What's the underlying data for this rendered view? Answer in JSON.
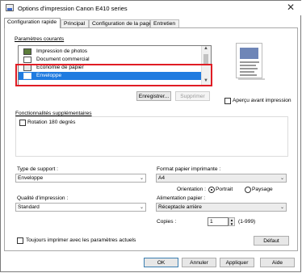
{
  "window": {
    "title": "Options d'impression Canon E410 series",
    "close_glyph": "✕"
  },
  "tabs": [
    {
      "label": "Configuration rapide",
      "active": true
    },
    {
      "label": "Principal",
      "active": false
    },
    {
      "label": "Configuration de la page",
      "active": false
    },
    {
      "label": "Entretien",
      "active": false
    }
  ],
  "quick_setup": {
    "common_settings_label": "Paramètres courants",
    "common_settings_items": [
      {
        "label": "Impression de photos",
        "icon": "photo-icon",
        "selected": false
      },
      {
        "label": "Document commercial",
        "icon": "document-icon",
        "selected": false
      },
      {
        "label": "Économie de papier",
        "icon": "paper-saving-icon",
        "selected": false
      },
      {
        "label": "Enveloppe",
        "icon": "envelope-icon",
        "selected": true
      }
    ],
    "save_button": "Enregistrer...",
    "delete_button": "Supprimer",
    "always_preview_label": "Aperçu avant impression",
    "additional_features_label": "Fonctionnalités supplémentaires",
    "rotate_180_label": "Rotation 180 degrés",
    "media_type_label": "Type de support :",
    "media_type_value": "Enveloppe",
    "printer_paper_size_label": "Format papier imprimante :",
    "printer_paper_size_value": "A4",
    "orientation_label": "Orientation :",
    "orientation_portrait": "Portrait",
    "orientation_landscape": "Paysage",
    "orientation_selected": "Portrait",
    "print_quality_label": "Qualité d'impression :",
    "print_quality_value": "Standard",
    "paper_source_label": "Alimentation papier :",
    "paper_source_value": "Réceptacle arrière",
    "copies_label": "Copies :",
    "copies_value": "1",
    "copies_range": "(1-999)",
    "always_print_label": "Toujours imprimer avec les paramètres actuels",
    "defaults_button": "Défaut"
  },
  "footer": {
    "ok": "OK",
    "cancel": "Annuler",
    "apply": "Appliquer",
    "help": "Aide"
  },
  "colors": {
    "selection": "#1f7be0",
    "highlight_box": "#e01c24",
    "preview_image": "#6f86b7"
  }
}
